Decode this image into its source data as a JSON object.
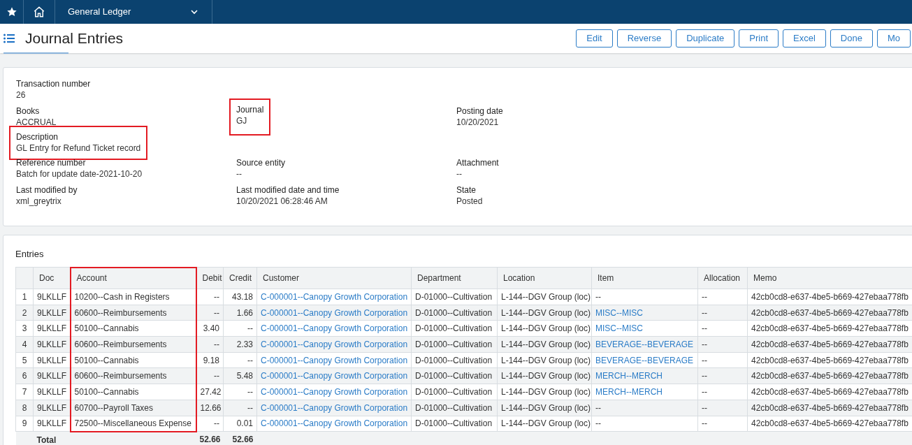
{
  "top_bar": {
    "module": "General Ledger"
  },
  "header": {
    "title": "Journal Entries",
    "buttons": [
      "Edit",
      "Reverse",
      "Duplicate",
      "Print",
      "Excel",
      "Done",
      "Mo"
    ]
  },
  "details": {
    "rows": [
      [
        {
          "label": "Transaction number",
          "value": "26",
          "highlighted": false
        }
      ],
      [
        {
          "label": "Books",
          "value": "ACCRUAL",
          "highlighted": false
        },
        {
          "label": "Journal",
          "value": "GJ",
          "highlighted": true
        },
        {
          "label": "Posting date",
          "value": "10/20/2021",
          "highlighted": false
        }
      ],
      [
        {
          "label": "Description",
          "value": "GL Entry for Refund Ticket record",
          "highlighted": true
        }
      ],
      [
        {
          "label": "Reference number",
          "value": "Batch for update date-2021-10-20",
          "highlighted": false
        },
        {
          "label": "Source entity",
          "value": "--",
          "highlighted": false
        },
        {
          "label": "Attachment",
          "value": "--",
          "highlighted": false
        }
      ],
      [
        {
          "label": "Last modified by",
          "value": "xml_greytrix",
          "highlighted": false
        },
        {
          "label": "Last modified date and time",
          "value": "10/20/2021 06:28:46 AM",
          "highlighted": false
        },
        {
          "label": "State",
          "value": "Posted",
          "highlighted": false
        }
      ]
    ]
  },
  "entries": {
    "title": "Entries",
    "columns": [
      {
        "kind": "index",
        "highlighted": false
      },
      {
        "label": "Doc",
        "kind": "text",
        "highlighted": false
      },
      {
        "label": "Account",
        "kind": "text",
        "highlighted": true
      },
      {
        "label": "Debit",
        "kind": "number",
        "highlighted": false
      },
      {
        "label": "Credit",
        "kind": "number",
        "highlighted": false
      },
      {
        "label": "Customer",
        "kind": "link",
        "highlighted": false
      },
      {
        "label": "Department",
        "kind": "text",
        "highlighted": false
      },
      {
        "label": "Location",
        "kind": "text",
        "highlighted": false
      },
      {
        "label": "Item",
        "kind": "link",
        "highlighted": false
      },
      {
        "label": "Allocation",
        "kind": "text",
        "highlighted": false
      },
      {
        "label": "Memo",
        "kind": "text",
        "highlighted": false
      }
    ],
    "rows": [
      [
        "1",
        "9LKLLF",
        "10200--Cash in Registers",
        "--",
        "43.18",
        "C-000001--Canopy Growth Corporation",
        "D-01000--Cultivation",
        "L-144--DGV Group (loc)",
        "--",
        "--",
        "42cb0cd8-e637-4be5-b669-427ebaa778fb"
      ],
      [
        "2",
        "9LKLLF",
        "60600--Reimbursements",
        "--",
        "1.66",
        "C-000001--Canopy Growth Corporation",
        "D-01000--Cultivation",
        "L-144--DGV Group (loc)",
        "MISC--MISC",
        "--",
        "42cb0cd8-e637-4be5-b669-427ebaa778fb"
      ],
      [
        "3",
        "9LKLLF",
        "50100--Cannabis",
        "3.40",
        "--",
        "C-000001--Canopy Growth Corporation",
        "D-01000--Cultivation",
        "L-144--DGV Group (loc)",
        "MISC--MISC",
        "--",
        "42cb0cd8-e637-4be5-b669-427ebaa778fb"
      ],
      [
        "4",
        "9LKLLF",
        "60600--Reimbursements",
        "--",
        "2.33",
        "C-000001--Canopy Growth Corporation",
        "D-01000--Cultivation",
        "L-144--DGV Group (loc)",
        "BEVERAGE--BEVERAGE",
        "--",
        "42cb0cd8-e637-4be5-b669-427ebaa778fb"
      ],
      [
        "5",
        "9LKLLF",
        "50100--Cannabis",
        "9.18",
        "--",
        "C-000001--Canopy Growth Corporation",
        "D-01000--Cultivation",
        "L-144--DGV Group (loc)",
        "BEVERAGE--BEVERAGE",
        "--",
        "42cb0cd8-e637-4be5-b669-427ebaa778fb"
      ],
      [
        "6",
        "9LKLLF",
        "60600--Reimbursements",
        "--",
        "5.48",
        "C-000001--Canopy Growth Corporation",
        "D-01000--Cultivation",
        "L-144--DGV Group (loc)",
        "MERCH--MERCH",
        "--",
        "42cb0cd8-e637-4be5-b669-427ebaa778fb"
      ],
      [
        "7",
        "9LKLLF",
        "50100--Cannabis",
        "27.42",
        "--",
        "C-000001--Canopy Growth Corporation",
        "D-01000--Cultivation",
        "L-144--DGV Group (loc)",
        "MERCH--MERCH",
        "--",
        "42cb0cd8-e637-4be5-b669-427ebaa778fb"
      ],
      [
        "8",
        "9LKLLF",
        "60700--Payroll Taxes",
        "12.66",
        "--",
        "C-000001--Canopy Growth Corporation",
        "D-01000--Cultivation",
        "L-144--DGV Group (loc)",
        "--",
        "--",
        "42cb0cd8-e637-4be5-b669-427ebaa778fb"
      ],
      [
        "9",
        "9LKLLF",
        "72500--Miscellaneous Expense",
        "--",
        "0.01",
        "C-000001--Canopy Growth Corporation",
        "D-01000--Cultivation",
        "L-144--DGV Group (loc)",
        "--",
        "--",
        "42cb0cd8-e637-4be5-b669-427ebaa778fb"
      ]
    ],
    "total": {
      "label": "Total",
      "debit": "52.66",
      "credit": "52.66"
    }
  }
}
